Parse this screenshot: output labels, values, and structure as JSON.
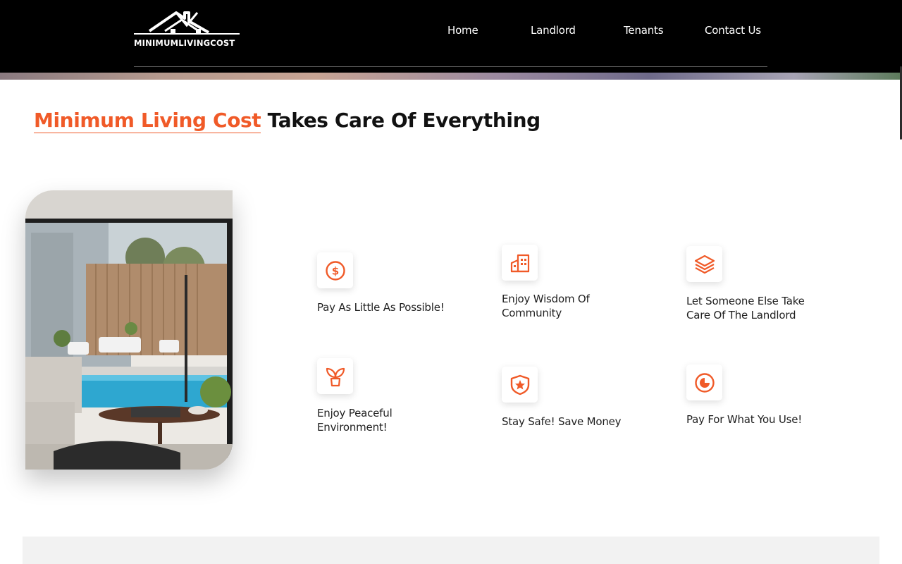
{
  "brand": {
    "logo_text": "MINIMUMLIVINGCOST"
  },
  "nav": {
    "items": [
      {
        "label": "Home"
      },
      {
        "label": "Landlord"
      },
      {
        "label": "Tenants"
      },
      {
        "label": "Contact Us"
      }
    ]
  },
  "headline": {
    "accent": "Minimum Living Cost",
    "rest": "Takes Care Of Everything"
  },
  "features": [
    {
      "label": "Pay As Little As Possible!",
      "icon": "dollar-circle-icon"
    },
    {
      "label": "Enjoy Wisdom Of Community",
      "icon": "buildings-icon"
    },
    {
      "label": "Let Someone Else Take Care Of The Landlord",
      "icon": "layers-icon"
    },
    {
      "label": "Enjoy Peaceful Environment!",
      "icon": "plant-icon"
    },
    {
      "label": "Stay Safe! Save Money",
      "icon": "shield-star-icon"
    },
    {
      "label": "Pay For What You Use!",
      "icon": "meter-icon"
    }
  ],
  "colors": {
    "accent": "#f05a28",
    "header_bg": "#000000",
    "text": "#111111"
  }
}
